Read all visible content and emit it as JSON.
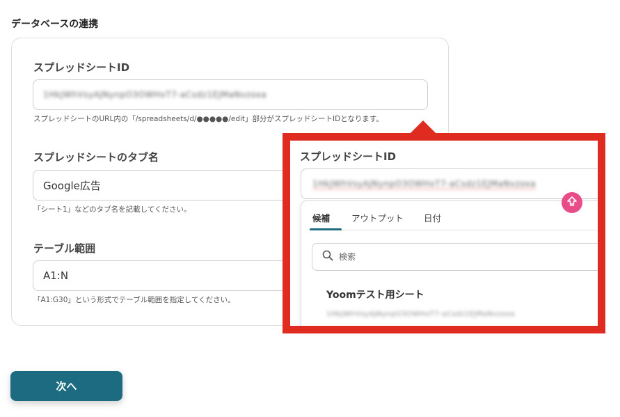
{
  "section_title": "データベースの連携",
  "form": {
    "spreadsheet_id": {
      "label": "スプレッドシートID",
      "value": "1HkJWhVsyAJNynpO3OWHxT7-aCsdz1EJMaNvzoxa",
      "hint": "スプレッドシートのURL内の「/spreadsheets/d/●●●●●/edit」部分がスプレッドシートIDとなります。"
    },
    "tab_name": {
      "label": "スプレッドシートのタブ名",
      "value": "Google広告",
      "hint": "「シート1」などのタブ名を記載してください。"
    },
    "table_range": {
      "label": "テーブル範囲",
      "value": "A1:N",
      "hint": "「A1:G30」という形式でテーブル範囲を指定してください。"
    }
  },
  "next_button": {
    "label": "次へ"
  },
  "callout": {
    "label": "スプレッドシートID",
    "value": "1HkJWhVsyAJNynpO3OWHxT7-aCsdz1EJMaNvzoxa",
    "tabs": [
      {
        "label": "候補",
        "active": true
      },
      {
        "label": "アウトプット",
        "active": false
      },
      {
        "label": "日付",
        "active": false
      }
    ],
    "search": {
      "placeholder": "検索"
    },
    "results": [
      {
        "title": "Yoomテスト用シート",
        "id": "1HkJWhVsyAJNynpO3OWHxT7-aCsdz1EJMaNvzoxa"
      }
    ]
  },
  "colors": {
    "primary": "#1c6b80",
    "highlight": "#e02b20",
    "badge": "#e84d8a"
  }
}
